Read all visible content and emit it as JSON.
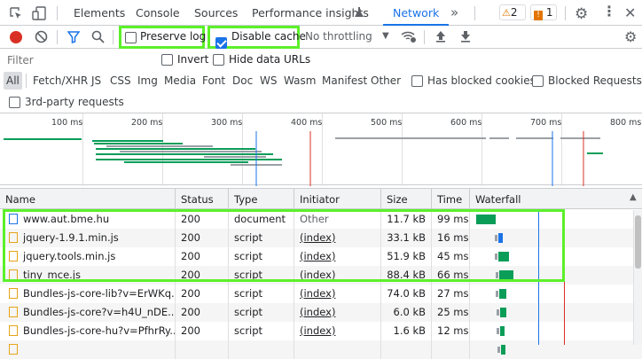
{
  "tabbar": {
    "tabs": [
      "Elements",
      "Console",
      "Sources",
      "Performance insights",
      "Network"
    ],
    "more": "»",
    "warnings": "2",
    "issues": "1"
  },
  "toolbar": {
    "preserve_log": "Preserve log",
    "disable_cache": "Disable cache",
    "throttling": "No throttling"
  },
  "filter": {
    "placeholder": "Filter",
    "invert": "Invert",
    "hide_data_urls": "Hide data URLs"
  },
  "types": [
    "All",
    "Fetch/XHR",
    "JS",
    "CSS",
    "Img",
    "Media",
    "Font",
    "Doc",
    "WS",
    "Wasm",
    "Manifest",
    "Other"
  ],
  "blocked_cookies": "Has blocked cookies",
  "blocked_requests": "Blocked Requests",
  "third_party": "3rd-party requests",
  "overview_ticks": [
    "100 ms",
    "200 ms",
    "300 ms",
    "400 ms",
    "500 ms",
    "600 ms",
    "700 ms",
    "800 ms"
  ],
  "columns": [
    "Name",
    "Status",
    "Type",
    "Initiator",
    "Size",
    "Time",
    "Waterfall"
  ],
  "rows": [
    {
      "name": "www.aut.bme.hu",
      "status": "200",
      "type": "document",
      "initiator": "Other",
      "size": "11.7 kB",
      "time": "99 ms",
      "kind": "doc"
    },
    {
      "name": "jquery-1.9.1.min.js",
      "status": "200",
      "type": "script",
      "initiator": "(index)",
      "size": "33.1 kB",
      "time": "16 ms",
      "kind": "js"
    },
    {
      "name": "jquery.tools.min.js",
      "status": "200",
      "type": "script",
      "initiator": "(index)",
      "size": "51.9 kB",
      "time": "45 ms",
      "kind": "js"
    },
    {
      "name": "tiny_mce.js",
      "status": "200",
      "type": "script",
      "initiator": "(index)",
      "size": "88.4 kB",
      "time": "66 ms",
      "kind": "js"
    },
    {
      "name": "Bundles-js-core-lib?v=ErWKq...",
      "status": "200",
      "type": "script",
      "initiator": "(index)",
      "size": "74.0 kB",
      "time": "27 ms",
      "kind": "js"
    },
    {
      "name": "Bundles-js-core?v=h4U_nDE...",
      "status": "200",
      "type": "script",
      "initiator": "(index)",
      "size": "6.0 kB",
      "time": "25 ms",
      "kind": "js"
    },
    {
      "name": "Bundles-js-core-hu?v=PfhrRy...",
      "status": "200",
      "type": "script",
      "initiator": "(index)",
      "size": "1.6 kB",
      "time": "12 ms",
      "kind": "js"
    },
    {
      "name": "",
      "status": "",
      "type": "",
      "initiator": "",
      "size": "",
      "time": "",
      "kind": "js"
    }
  ],
  "colors": {
    "accent": "#1a73e8",
    "highlight": "#5cf02a",
    "record": "#d93025",
    "waterfall": "#0a9d58"
  }
}
